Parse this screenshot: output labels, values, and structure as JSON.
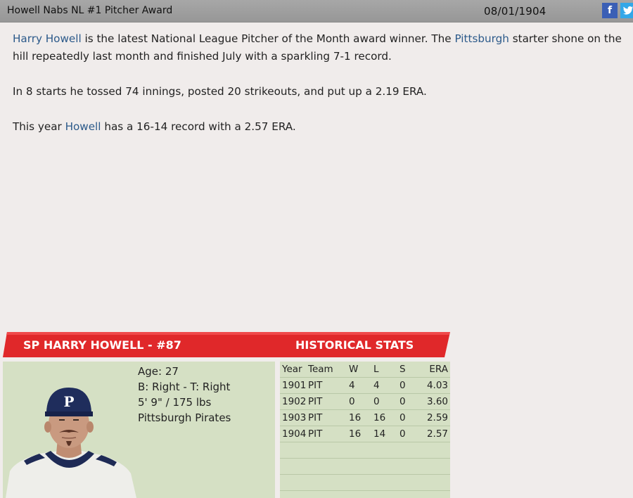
{
  "header": {
    "title": "Howell Nabs NL #1 Pitcher Award",
    "date": "08/01/1904",
    "facebook_glyph": "f",
    "twitter_glyph": "t"
  },
  "article": {
    "p1_link1": "Harry Howell",
    "p1_text1": " is the latest National League Pitcher of the Month award winner. The ",
    "p1_link2": "Pittsburgh",
    "p1_text2": " starter shone on the hill repeatedly last month and finished July with a sparkling 7-1 record.",
    "p2": "In 8 starts he tossed 74 innings, posted 20 strikeouts, and put up a 2.19 ERA.",
    "p3_text1": "This year ",
    "p3_link": "Howell",
    "p3_text2": " has a 16-14 record with a 2.57 ERA."
  },
  "player": {
    "heading": "SP HARRY HOWELL - #87",
    "age": "Age: 27",
    "bats_throws": "B: Right - T: Right",
    "size": "5' 9\" / 175 lbs",
    "team": "Pittsburgh Pirates",
    "cap_letter": "P"
  },
  "stats": {
    "heading": "HISTORICAL STATS",
    "columns": {
      "year": "Year",
      "team": "Team",
      "w": "W",
      "l": "L",
      "s": "S",
      "era": "ERA"
    },
    "rows": [
      {
        "year": "1901",
        "team": "PIT",
        "w": "4",
        "l": "4",
        "s": "0",
        "era": "4.03"
      },
      {
        "year": "1902",
        "team": "PIT",
        "w": "0",
        "l": "0",
        "s": "0",
        "era": "3.60"
      },
      {
        "year": "1903",
        "team": "PIT",
        "w": "16",
        "l": "16",
        "s": "0",
        "era": "2.59"
      },
      {
        "year": "1904",
        "team": "PIT",
        "w": "16",
        "l": "14",
        "s": "0",
        "era": "2.57"
      }
    ]
  },
  "colors": {
    "banner_red": "#e0282a",
    "panel_green": "#d5e0c4",
    "link_blue": "#2c5a8a",
    "facebook": "#3b5fb5",
    "twitter": "#33a7e8"
  },
  "icons": [
    "facebook-icon",
    "twitter-icon"
  ]
}
